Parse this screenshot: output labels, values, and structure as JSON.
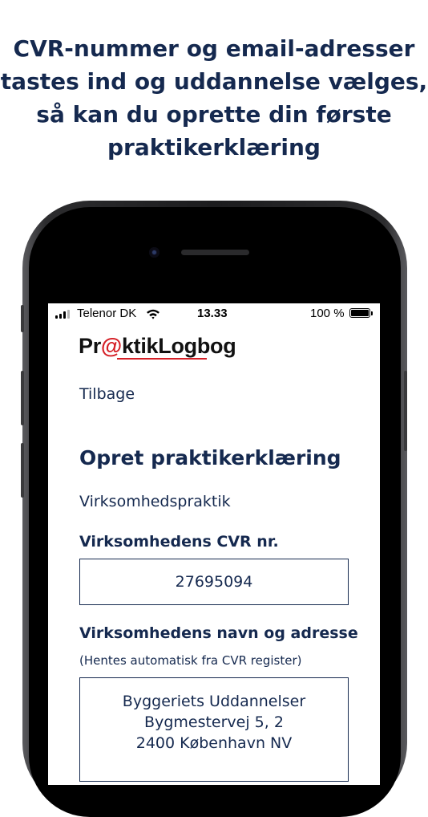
{
  "headline": {
    "lines": [
      "CVR-nummer og email-adresser",
      "tastes ind og uddannelse vælges,",
      "så kan du oprette din første",
      "praktikerklæring"
    ]
  },
  "status_bar": {
    "carrier": "Telenor DK",
    "time": "13.33",
    "battery": "100 %",
    "battery_level": 1.0
  },
  "app": {
    "logo": {
      "part1": "Pr",
      "at": "@",
      "part2": "ktikLogbog"
    },
    "back_label": "Tilbage",
    "title": "Opret praktikerklæring",
    "subtitle": "Virksomhedspraktik",
    "cvr": {
      "label": "Virksomhedens CVR nr.",
      "value": "27695094"
    },
    "company": {
      "label": "Virksomhedens navn og adresse",
      "hint": "(Hentes automatisk fra CVR register)",
      "lines": [
        "Byggeriets Uddannelser",
        "Bygmestervej 5, 2",
        "2400 København NV"
      ]
    }
  },
  "colors": {
    "brand_navy": "#15294f",
    "brand_red": "#d51f26"
  },
  "icons": [
    "signal-icon",
    "wifi-icon",
    "battery-icon"
  ]
}
